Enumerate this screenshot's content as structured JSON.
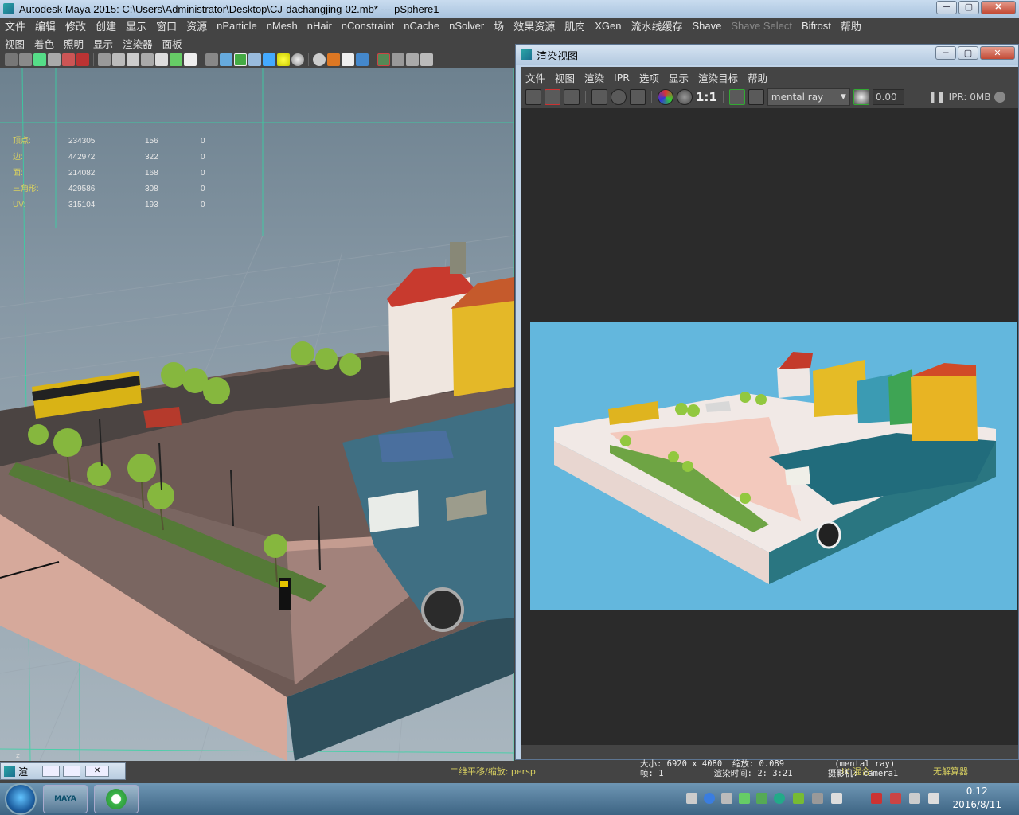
{
  "window": {
    "title": "Autodesk Maya 2015: C:\\Users\\Administrator\\Desktop\\CJ-dachangjing-02.mb*   ---   pSphere1",
    "min": "─",
    "max": "▢",
    "close": "✕"
  },
  "main_menu": [
    "文件",
    "编辑",
    "修改",
    "创建",
    "显示",
    "窗口",
    "资源",
    "nParticle",
    "nMesh",
    "nHair",
    "nConstraint",
    "nCache",
    "nSolver",
    "场",
    "效果资源",
    "肌肉",
    "XGen",
    "流水线缓存",
    "Shave",
    "Shave Select",
    "Bifrost",
    "帮助"
  ],
  "viewport_menu": [
    "视图",
    "着色",
    "照明",
    "显示",
    "渲染器",
    "面板"
  ],
  "hud": {
    "rows": [
      {
        "label": "顶点:",
        "a": "234305",
        "b": "156",
        "c": "0"
      },
      {
        "label": "边:",
        "a": "442972",
        "b": "322",
        "c": "0"
      },
      {
        "label": "面:",
        "a": "214082",
        "b": "168",
        "c": "0"
      },
      {
        "label": "三角形:",
        "a": "429586",
        "b": "308",
        "c": "0"
      },
      {
        "label": "UV:",
        "a": "315104",
        "b": "193",
        "c": "0"
      }
    ]
  },
  "render_view": {
    "title": "渲染视图",
    "menu": [
      "文件",
      "视图",
      "渲染",
      "IPR",
      "选项",
      "显示",
      "渲染目标",
      "帮助"
    ],
    "ratio_label": "1:1",
    "renderer": "mental ray",
    "exposure": "0.00",
    "ipr_mem": "IPR: 0MB",
    "info_line1": "大小: 6920 x 4080  缩放: 0.089          (mental ray)",
    "info_line2": "帧: 1          渲染时间: 2: 3:21       摄影机: camera1"
  },
  "status": {
    "mini_panel_label": "渲",
    "nav_text": "二维平移/缩放: persp",
    "ik_label": "IK 混合:",
    "solver_label": "无解算器"
  },
  "taskbar": {
    "maya_label": "MAYA",
    "time": "0:12",
    "date": "2016/8/11"
  },
  "colors": {
    "title_gradient_top": "#c9dcef",
    "maya_bg": "#444444",
    "viewport_sky": "#8798a5",
    "render_bg": "#63b7dd"
  }
}
